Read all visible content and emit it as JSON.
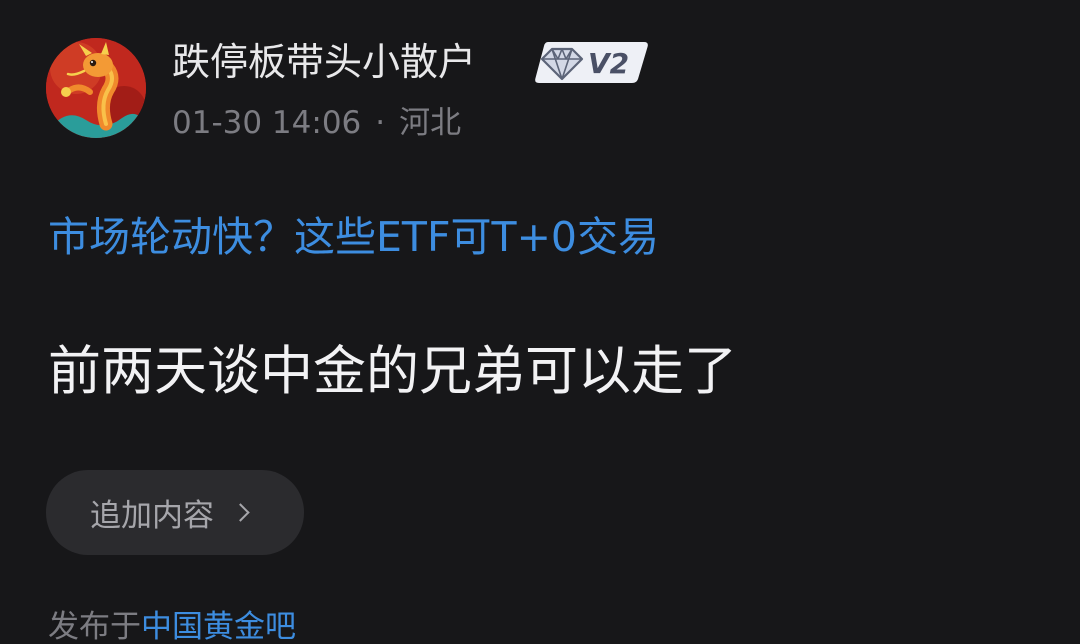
{
  "author": {
    "name": "跌停板带头小散户",
    "level": "V2",
    "avatar_icon": "dragon-avatar-icon"
  },
  "meta": {
    "time": "01-30 14:06",
    "separator": "·",
    "location": "河北"
  },
  "post": {
    "linked_title": "市场轮动快？这些ETF可T+0交易",
    "body": "前两天谈中金的兄弟可以走了"
  },
  "append_button": {
    "label": "追加内容"
  },
  "published": {
    "prefix": "发布于",
    "forum": "中国黄金吧"
  },
  "colors": {
    "background": "#171719",
    "link": "#3d8de0",
    "muted": "#7c7c82"
  }
}
